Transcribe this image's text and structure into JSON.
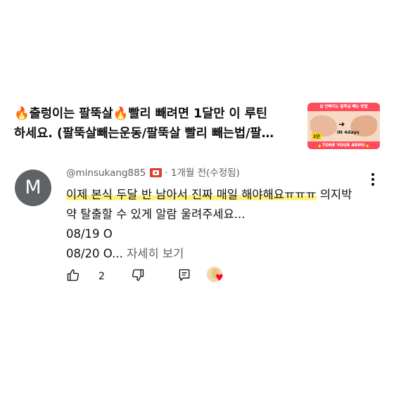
{
  "video": {
    "title_line1": "🔥출렁이는 팔뚝살🔥빨리 빼려면 1달만 이 루틴",
    "title_line2": "하세요. (팔뚝살빼는운동/팔뚝살 빨리 빼는법/팔…",
    "thumbnail": {
      "banner": "살 안빠지는 팔뚝살 빼는 방법",
      "days": "IN 4days",
      "step": "1단",
      "footer": "🔥TONE YOUR ARMS🔥"
    }
  },
  "comment": {
    "avatar_letter": "M",
    "author": "@minsukang885",
    "separator": "·",
    "time": "1개월 전(수정됨)",
    "text_highlight": "이제 본식 두달 반 남아서 진짜 매일 해야해요ㅠㅠㅠ",
    "text_rest_line1": " 의지박",
    "text_line2": "약 탈출할 수 있게 알람 울려주세요...",
    "text_line3": "08/19 O",
    "text_line4_prefix": "08/20 O...",
    "read_more": " 자세히 보기",
    "like_count": "2"
  },
  "icons": {
    "like": "thumbs-up-icon",
    "dislike": "thumbs-down-icon",
    "reply": "reply-comment-icon",
    "more": "more-vert-icon",
    "badge": "membership-badge-icon",
    "creator_heart": "creator-heart-icon"
  },
  "colors": {
    "highlight": "#fff27a",
    "badge": "#e33b2e",
    "heart": "#ff0033",
    "avatar_bg": "#5f6366",
    "secondary_text": "#606060"
  }
}
